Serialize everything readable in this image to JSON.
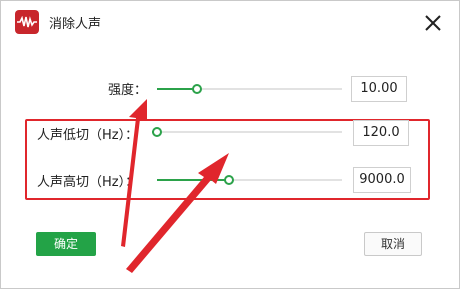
{
  "window": {
    "title": "消除人声",
    "app_icon": "waveform-icon",
    "close_icon": "close-icon"
  },
  "controls": [
    {
      "label": "强度：",
      "value": "10.00",
      "level": 0.2
    },
    {
      "label": "人声低切（Hz）：",
      "value": "120.0",
      "level": 0.0
    },
    {
      "label": "人声高切（Hz）：",
      "value": "9000.0",
      "level": 0.38
    }
  ],
  "buttons": {
    "ok": "确定",
    "cancel": "取消"
  },
  "colors": {
    "accent": "#2ba24a",
    "highlight": "#e0262c",
    "app_icon": "#c8262c"
  }
}
